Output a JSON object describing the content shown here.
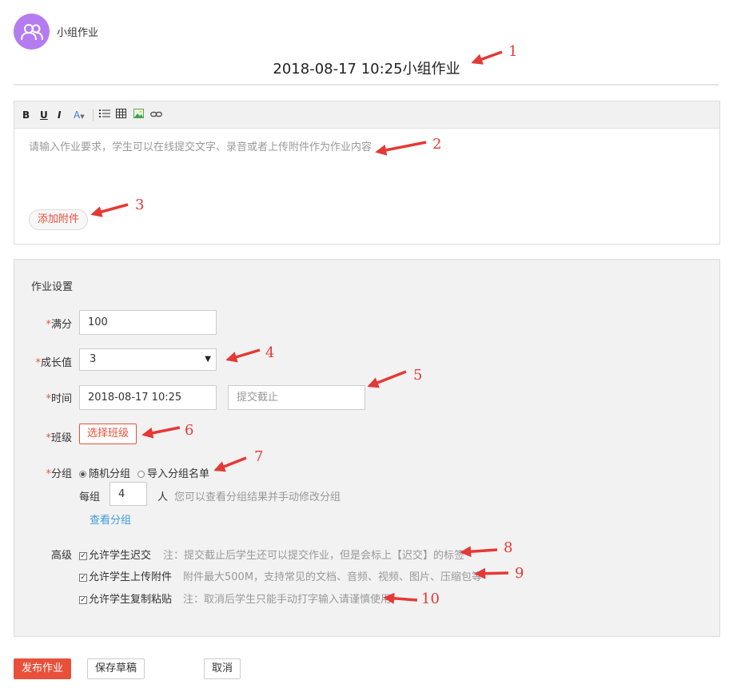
{
  "header": {
    "group_name": "小组作业",
    "title": "2018-08-17 10:25小组作业"
  },
  "editor": {
    "toolbar": {
      "bold": "B",
      "underline": "U",
      "italic": "I",
      "font_color": "A"
    },
    "placeholder": "请输入作业要求，学生可以在线提交文字、录音或者上传附件作为作业内容",
    "attach_label": "添加附件"
  },
  "settings": {
    "title": "作业设置",
    "required_mark": "*",
    "full_score": {
      "label": "满分",
      "value": "100"
    },
    "growth": {
      "label": "成长值",
      "value": "3"
    },
    "time": {
      "label": "时间",
      "start": "2018-08-17 10:25",
      "deadline_placeholder": "提交截止"
    },
    "class": {
      "label": "班级",
      "button": "选择班级"
    },
    "group": {
      "label": "分组",
      "options": [
        "随机分组",
        "导入分组名单"
      ],
      "selected": "随机分组",
      "per_group_label": "每组",
      "per_group_value": "4",
      "unit": "人",
      "hint": "您可以查看分组结果并手动修改分组",
      "view_link": "查看分组"
    },
    "advanced": {
      "label": "高级",
      "items": [
        {
          "label": "允许学生迟交",
          "checked": true,
          "note": "注：提交截止后学生还可以提交作业，但是会标上【迟交】的标签"
        },
        {
          "label": "允许学生上传附件",
          "checked": true,
          "note": "附件最大500M，支持常见的文档、音频、视频、图片、压缩包等"
        },
        {
          "label": "允许学生复制粘贴",
          "checked": true,
          "note": "注：取消后学生只能手动打字输入请谨慎使用"
        }
      ]
    }
  },
  "actions": {
    "publish": "发布作业",
    "save_draft": "保存草稿",
    "cancel": "取消"
  },
  "annotations": [
    "1",
    "2",
    "3",
    "4",
    "5",
    "6",
    "7",
    "8",
    "9",
    "10"
  ],
  "colors": {
    "accent": "#e8503a",
    "avatar": "#b47cf0",
    "link": "#3a9fdc",
    "annotation": "#e53935"
  }
}
